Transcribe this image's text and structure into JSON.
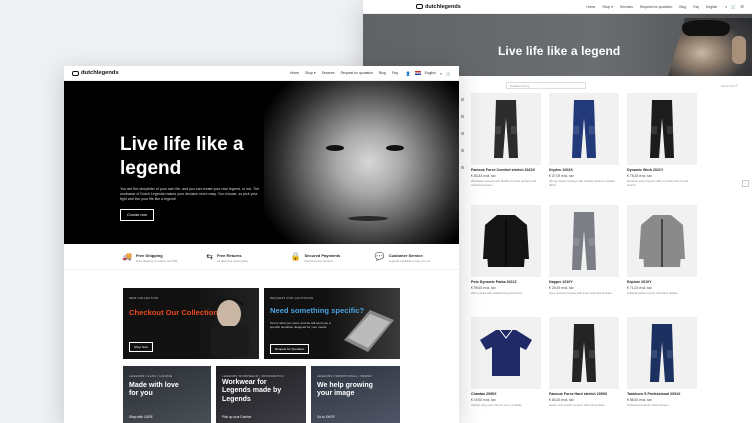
{
  "back_page": {
    "logo": "dutchlegends",
    "nav": [
      "Home",
      "Shop ▾",
      "Services",
      "Request for quotation",
      "Blog",
      "Faq",
      "English"
    ],
    "hero_title": "Live life like a legend",
    "sort_placeholder": "Default sorting",
    "view_options": "Show ▾ ⊞ ☰",
    "products": [
      {
        "name": "Famous Force Comfort stretch 2022X",
        "price": "€ 83,43 excl. tax",
        "desc": "Workwear trousers with flexible fit, knee pockets and reinforced seams.",
        "type": "pants",
        "color": "#2c2c2c"
      },
      {
        "name": "Dryden 1002X",
        "price": "€ 37,09 excl. tax",
        "desc": "Strong worker trousers with multiple pockets, durable fabric.",
        "type": "pants",
        "color": "#233a7a"
      },
      {
        "name": "Dynamic Work 2021Y",
        "price": "€ 78,33 excl. tax",
        "desc": "Dynamic work trousers with a modern slim fit and stretch.",
        "type": "pants",
        "color": "#1c1c1c"
      },
      {
        "name": "Polo Dynamic Parka 2021Z",
        "price": "€ 99,60 excl. tax",
        "desc": "Warm parka with padded lining and hood.",
        "type": "jacket",
        "color": "#151515"
      },
      {
        "name": "Dapper 1010Y",
        "price": "€ 25,49 excl. tax",
        "desc": "Grey working trousers with knee pads and pockets.",
        "type": "pants",
        "color": "#7b7f85"
      },
      {
        "name": "Explore 2010Y",
        "price": "€ 71,03 excl. tax",
        "desc": "Softshell jacket in grey with black details.",
        "type": "jacket",
        "color": "#8a8a8a"
      },
      {
        "name": "Chantax 2090X",
        "price": "€ 19,92 excl. tax",
        "desc": "Classic navy polo shirt for every workday.",
        "type": "polo",
        "color": "#1f2a66"
      },
      {
        "name": "Famous Force Hard stretch 2090X",
        "price": "€ 84,20 excl. tax",
        "desc": "Heavy duty stretch trousers with tool pockets.",
        "type": "pants",
        "color": "#242424"
      },
      {
        "name": "Tankhorn S Professional 2091X",
        "price": "€ 86,92 excl. tax",
        "desc": "Professional denim work trousers.",
        "type": "pants",
        "color": "#1c3160"
      }
    ]
  },
  "front_page": {
    "logo": "dutchlegends",
    "nav": [
      "Home",
      "Shop ▾",
      "Services",
      "Request for quotation",
      "Blog",
      "Faq",
      "English"
    ],
    "hero": {
      "title": "Live life like a legend",
      "text": "You are the storyteller of your own life, and you can create your own legend, or not. The workwear of Dutch Legends makes your decision more easy. You choose, so pick your fight and live your life like a legend!",
      "button": "Choose now"
    },
    "usps": [
      {
        "title": "Free Shipping",
        "sub": "Free shipping on orders over €50",
        "icon": "truck-icon"
      },
      {
        "title": "Free Returns",
        "sub": "14 days free return policy",
        "icon": "return-icon"
      },
      {
        "title": "Secured Payments",
        "sub": "Payments are secured",
        "icon": "lock-icon"
      },
      {
        "title": "Customer Service",
        "sub": "Legends available to help you out",
        "icon": "chat-icon"
      }
    ],
    "features": [
      {
        "eyebrow": "NEW COLLECTION",
        "title": "Checkout Our Collection",
        "button": "Shop Now",
        "accent": "#e8491d"
      },
      {
        "eyebrow": "REQUEST FOR QUOTATION",
        "title": "Need something specific?",
        "text": "Tell us what you need, and we will send you a specific quotation designed for your needs.",
        "button": "Request for Quotation",
        "accent": "#4aa3df"
      },
      {
        "eyebrow": "LEGENDS CLASS | HOODIE",
        "title": "Made with love for you",
        "link": "Shop with CARE",
        "accent": "#ffffff"
      },
      {
        "eyebrow": "LEGENDS WORKWEAR | CROSSMATCH",
        "title": "Workwear for Legends made by Legends",
        "link": "Pick up your Dutchie",
        "accent": "#ffffff"
      },
      {
        "eyebrow": "LEGENDS PROMOTIONAL | BRAND",
        "title": "We help growing your image",
        "link": "Go to SHOP",
        "accent": "#ffffff"
      }
    ]
  }
}
